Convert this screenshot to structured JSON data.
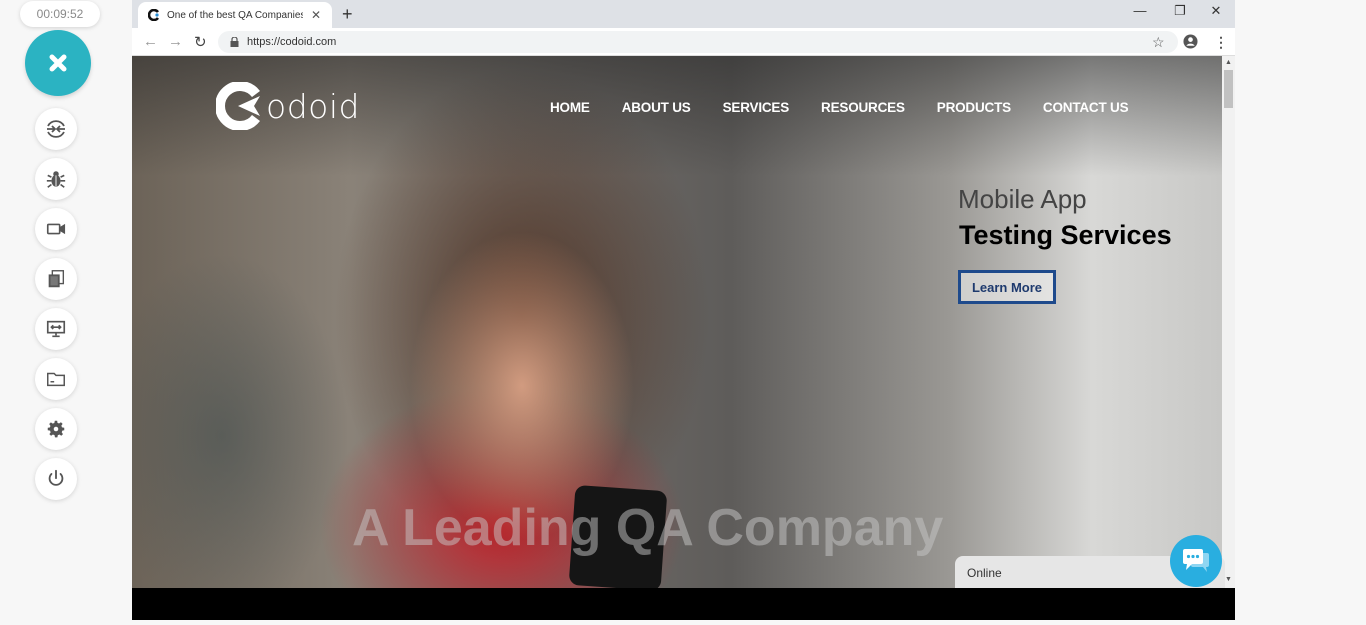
{
  "recorder": {
    "timer": "00:09:52",
    "accent": "#2bb3c2",
    "tools": [
      {
        "icon": "switch-arrows-icon",
        "name": "switch-tool"
      },
      {
        "icon": "bug-icon",
        "name": "bug-tool"
      },
      {
        "icon": "video-camera-icon",
        "name": "video-tool"
      },
      {
        "icon": "screenshots-icon",
        "name": "screenshots-tool"
      },
      {
        "icon": "screen-share-icon",
        "name": "screen-tool"
      },
      {
        "icon": "folder-icon",
        "name": "folder-tool"
      },
      {
        "icon": "gear-icon",
        "name": "settings-tool"
      },
      {
        "icon": "power-icon",
        "name": "power-tool"
      }
    ]
  },
  "browser": {
    "tab_title": "One of the best QA Companies |",
    "url": "https://codoid.com",
    "new_tab": "+",
    "controls": {
      "minimize": "—",
      "restore": "❐",
      "close": "✕"
    }
  },
  "site": {
    "logo_text": "odoid",
    "nav": [
      "HOME",
      "ABOUT US",
      "SERVICES",
      "RESOURCES",
      "PRODUCTS",
      "CONTACT US"
    ],
    "promo_subtitle": "Mobile App",
    "promo_title": "Testing Services",
    "cta_label": "Learn More",
    "tagline": "A Leading QA Company",
    "chat_status": "Online",
    "brand_blue": "#1e4a8c",
    "chat_color": "#29aee0"
  }
}
